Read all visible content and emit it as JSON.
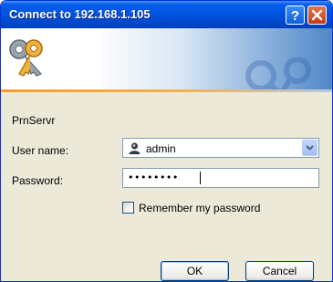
{
  "window": {
    "title": "Connect to 192.168.1.105"
  },
  "titlebar": {
    "help_icon": "question-mark-icon",
    "close_icon": "close-x-icon"
  },
  "banner": {
    "icon": "keys-icon",
    "watermark": "keys-watermark-icon"
  },
  "dialog": {
    "realm": "PrnServr",
    "user_label": "User name:",
    "user_value": "admin",
    "password_label": "Password:",
    "password_masked": "••••••••",
    "remember_label": "Remember my password",
    "remember_checked": false
  },
  "buttons": {
    "ok_label": "OK",
    "cancel_label": "Cancel"
  },
  "colors": {
    "titlebar": "#0054e3",
    "window_bg": "#ece9d8",
    "close_button": "#d5532b",
    "banner_accent": "#ff9b27"
  }
}
